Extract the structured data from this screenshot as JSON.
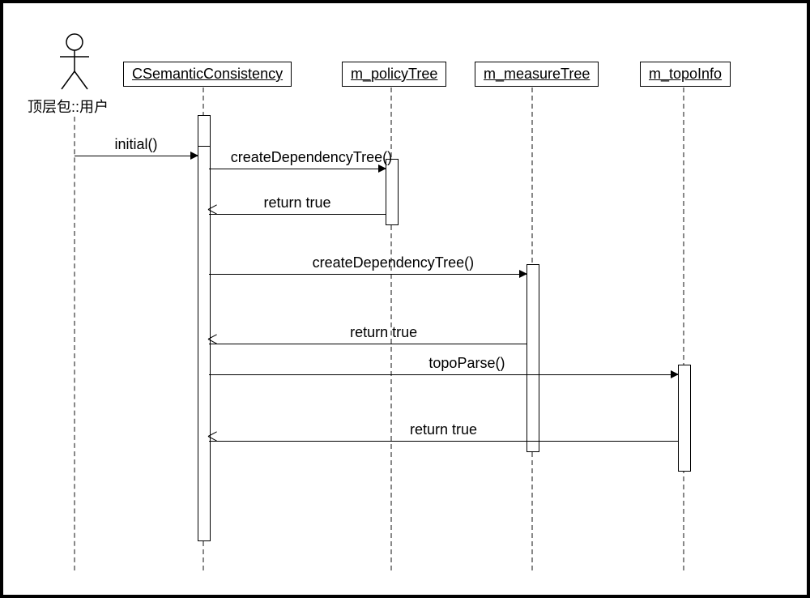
{
  "actor": {
    "label": "顶层包::用户"
  },
  "lifelines": {
    "l1": "CSemanticConsistency",
    "l2": "m_policyTree",
    "l3": "m_measureTree",
    "l4": "m_topoInfo"
  },
  "messages": {
    "m1": "initial()",
    "m2": "createDependencyTree()",
    "m3": "return true",
    "m4": "createDependencyTree()",
    "m5": "return true",
    "m6": "topoParse()",
    "m7": "return true"
  },
  "chart_data": {
    "type": "sequence_diagram",
    "participants": [
      {
        "id": "user",
        "label": "顶层包::用户",
        "kind": "actor"
      },
      {
        "id": "csc",
        "label": "CSemanticConsistency",
        "kind": "object"
      },
      {
        "id": "policy",
        "label": "m_policyTree",
        "kind": "object"
      },
      {
        "id": "measure",
        "label": "m_measureTree",
        "kind": "object"
      },
      {
        "id": "topo",
        "label": "m_topoInfo",
        "kind": "object"
      }
    ],
    "messages": [
      {
        "from": "user",
        "to": "csc",
        "label": "initial()",
        "type": "call"
      },
      {
        "from": "csc",
        "to": "policy",
        "label": "createDependencyTree()",
        "type": "call"
      },
      {
        "from": "policy",
        "to": "csc",
        "label": "return true",
        "type": "return"
      },
      {
        "from": "csc",
        "to": "measure",
        "label": "createDependencyTree()",
        "type": "call"
      },
      {
        "from": "measure",
        "to": "csc",
        "label": "return true",
        "type": "return"
      },
      {
        "from": "csc",
        "to": "topo",
        "label": "topoParse()",
        "type": "call"
      },
      {
        "from": "topo",
        "to": "csc",
        "label": "return true",
        "type": "return"
      }
    ]
  }
}
